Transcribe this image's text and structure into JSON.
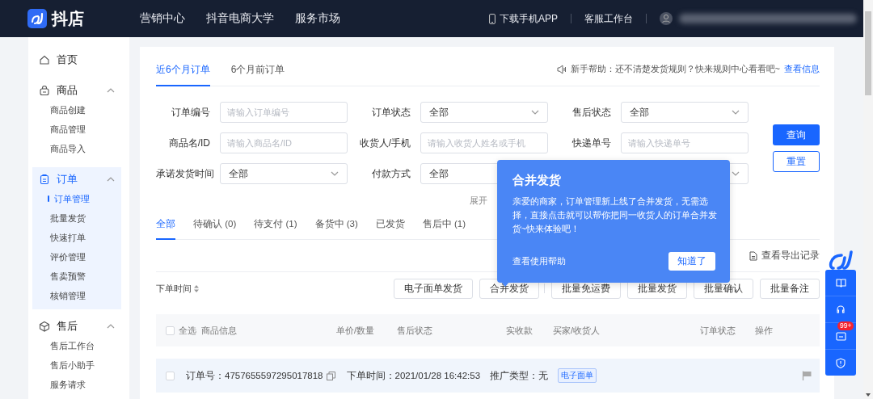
{
  "header": {
    "logo_text": "抖店",
    "nav": [
      "营销中心",
      "抖音电商大学",
      "服务市场"
    ],
    "links": [
      {
        "label": "下载手机APP",
        "kind": "phone"
      },
      {
        "label": "客服工作台",
        "kind": "plain"
      }
    ]
  },
  "sidebar": {
    "items": [
      {
        "label": "首页",
        "active": false
      },
      {
        "label": "商品",
        "active": false,
        "expanded": true,
        "children": [
          {
            "label": "商品创建",
            "selected": false
          },
          {
            "label": "商品管理",
            "selected": false
          },
          {
            "label": "商品导入",
            "selected": false
          }
        ]
      },
      {
        "label": "订单",
        "active": true,
        "expanded": true,
        "children": [
          {
            "label": "订单管理",
            "selected": true
          },
          {
            "label": "批量发货",
            "selected": false
          },
          {
            "label": "快速打单",
            "selected": false
          },
          {
            "label": "评价管理",
            "selected": false
          },
          {
            "label": "售卖预警",
            "selected": false
          },
          {
            "label": "核销管理",
            "selected": false
          }
        ]
      },
      {
        "label": "售后",
        "active": false,
        "expanded": true,
        "children": [
          {
            "label": "售后工作台",
            "selected": false
          },
          {
            "label": "售后小助手",
            "selected": false
          },
          {
            "label": "服务请求",
            "selected": false
          }
        ]
      }
    ]
  },
  "order_tabs": [
    {
      "label": "近6个月订单",
      "selected": true
    },
    {
      "label": "6个月前订单",
      "selected": false
    }
  ],
  "notice": {
    "text": "新手帮助：还不清楚发货规则？快来规则中心看看吧~",
    "link": "查看信息"
  },
  "filters": [
    [
      {
        "label": "订单编号",
        "kind": "input",
        "placeholder": "请输入订单编号"
      },
      {
        "label": "订单状态",
        "kind": "select",
        "value": "全部"
      },
      {
        "label": "售后状态",
        "kind": "select",
        "value": "全部"
      }
    ],
    [
      {
        "label": "商品名/ID",
        "kind": "input",
        "placeholder": "请输入商品名/ID"
      },
      {
        "label": "收货人/手机",
        "kind": "input",
        "placeholder": "请输入收货人姓名或手机"
      },
      {
        "label": "快递单号",
        "kind": "input",
        "placeholder": "请输入快递单号"
      }
    ],
    [
      {
        "label": "承诺发货时间",
        "kind": "select",
        "value": "全部"
      },
      {
        "label": "付款方式",
        "kind": "select",
        "value": "全部"
      },
      {
        "kind": "select"
      }
    ]
  ],
  "filter_buttons": [
    {
      "label": "查询",
      "kind": "primary"
    },
    {
      "label": "重置",
      "kind": "secondary"
    }
  ],
  "expand_label": "展开",
  "status_tabs": [
    {
      "label": "全部",
      "selected": true
    },
    {
      "label": "待确认 (0)",
      "selected": false
    },
    {
      "label": "待支付 (1)",
      "selected": false
    },
    {
      "label": "备货中 (3)",
      "selected": false
    },
    {
      "label": "已发货",
      "selected": false
    },
    {
      "label": "售后中 (1)",
      "selected": false
    }
  ],
  "export_link": "查看导出记录",
  "sort_label": "下单时间",
  "action_buttons": [
    "电子面单发货",
    "合并发货",
    "批量免运费",
    "批量发货",
    "批量确认",
    "批量备注"
  ],
  "table": {
    "select_all": {
      "label": "全选",
      "checked": false
    },
    "columns": [
      {
        "label": "商品信息"
      },
      {
        "label": "单价/数量"
      },
      {
        "label": "售后状态"
      },
      {
        "label": "实收款"
      },
      {
        "label": "买家/收货人"
      },
      {
        "label": "订单状态"
      },
      {
        "label": "操作"
      }
    ]
  },
  "order": {
    "checked": false,
    "order_no": "订单号：4757655597295017818",
    "time": "下单时间：2021/01/28 16:42:53",
    "promo": "推广类型：无",
    "tag": "电子面单"
  },
  "popover": {
    "title": "合并发货",
    "body": "亲爱的商家，订单管理新上线了合并发货，无需选择，直接点击就可以帮你把同一收货人的订单合并发货~快来体验吧！",
    "help_link": "查看使用帮助",
    "button": "知道了"
  },
  "side_widget": {
    "badge": "99+"
  }
}
